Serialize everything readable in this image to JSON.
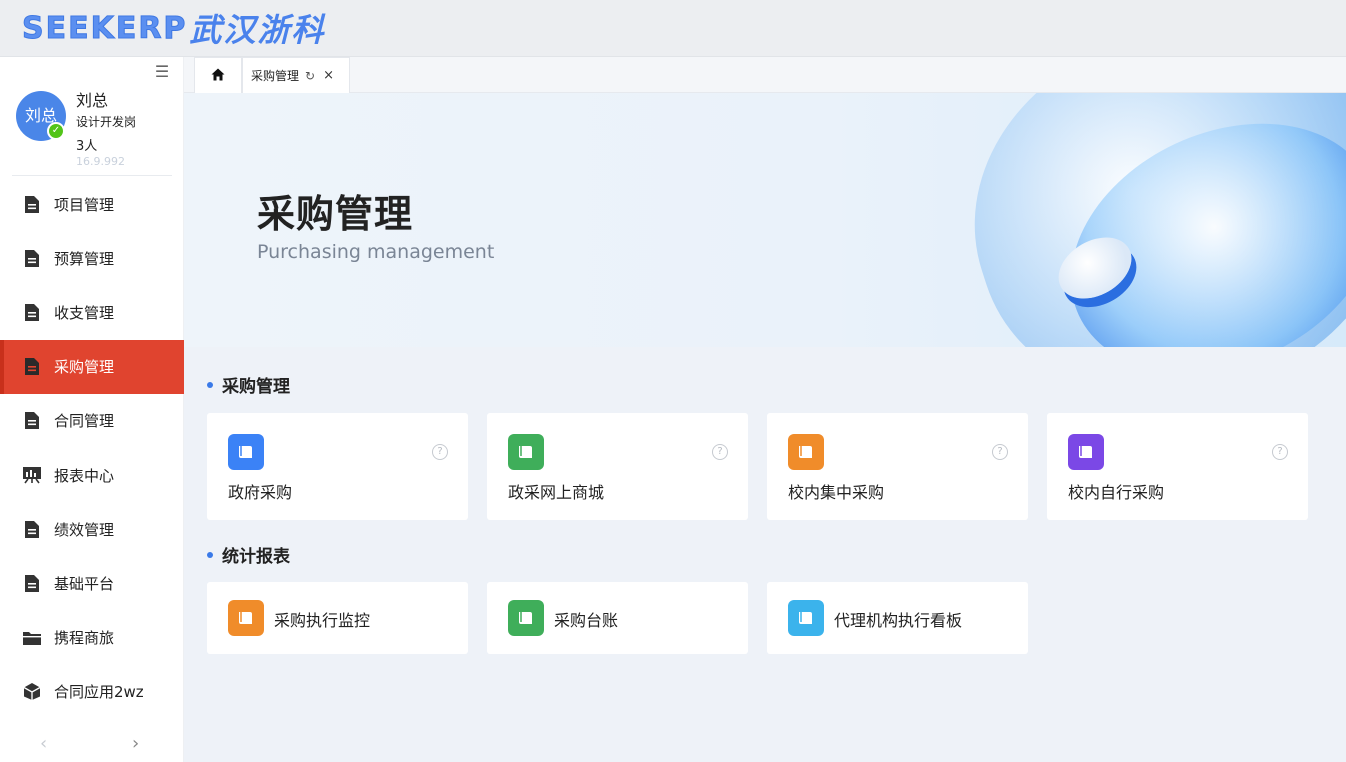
{
  "header": {
    "logo_en": "SEEKERP",
    "logo_cn": "武汉浙科"
  },
  "sidebar": {
    "user": {
      "avatar_text": "刘总",
      "name": "刘总",
      "role": "设计开发岗",
      "count": "3人",
      "extra": "16.9.992"
    },
    "items": [
      {
        "label": "项目管理",
        "icon": "document-icon"
      },
      {
        "label": "预算管理",
        "icon": "document-icon"
      },
      {
        "label": "收支管理",
        "icon": "document-icon"
      },
      {
        "label": "采购管理",
        "icon": "document-icon",
        "active": true
      },
      {
        "label": "合同管理",
        "icon": "document-icon"
      },
      {
        "label": "报表中心",
        "icon": "chart-board-icon"
      },
      {
        "label": "绩效管理",
        "icon": "document-icon"
      },
      {
        "label": "基础平台",
        "icon": "document-icon"
      },
      {
        "label": "携程商旅",
        "icon": "folder-icon"
      },
      {
        "label": "合同应用2wz",
        "icon": "cube-icon"
      }
    ]
  },
  "tabs": {
    "home_icon": "home-icon",
    "active_tab": {
      "label": "采购管理"
    }
  },
  "banner": {
    "title": "采购管理",
    "subtitle": "Purchasing management"
  },
  "sections": [
    {
      "title": "采购管理",
      "cards": [
        {
          "label": "政府采购",
          "color": "#3b82f6"
        },
        {
          "label": "政采网上商城",
          "color": "#3fae5a"
        },
        {
          "label": "校内集中采购",
          "color": "#f08c2a"
        },
        {
          "label": "校内自行采购",
          "color": "#7b48e6"
        }
      ]
    },
    {
      "title": "统计报表",
      "cards": [
        {
          "label": "采购执行监控",
          "color": "#f08c2a"
        },
        {
          "label": "采购台账",
          "color": "#3fae5a"
        },
        {
          "label": "代理机构执行看板",
          "color": "#3bb3ec"
        }
      ]
    }
  ],
  "colors": {
    "accent": "#e0442f",
    "primary": "#3a7ae8",
    "page_bg": "#eef2f8"
  }
}
